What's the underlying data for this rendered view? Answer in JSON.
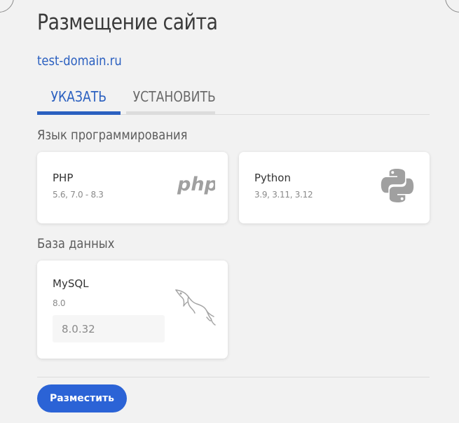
{
  "page": {
    "title": "Размещение сайта",
    "domain": "test-domain.ru"
  },
  "tabs": [
    {
      "label": "УКАЗАТЬ",
      "active": true
    },
    {
      "label": "УСТАНОВИТЬ",
      "active": false
    }
  ],
  "sections": {
    "language_label": "Язык программирования",
    "database_label": "База данных"
  },
  "languages": [
    {
      "name": "PHP",
      "versions": "5.6, 7.0 - 8.3",
      "icon": "php-logo-icon",
      "logo_text": "php"
    },
    {
      "name": "Python",
      "versions": "3.9, 3.11, 3.12",
      "icon": "python-logo-icon"
    }
  ],
  "database": {
    "name": "MySQL",
    "version": "8.0",
    "input_value": "8.0.32",
    "icon": "mysql-dolphin-icon"
  },
  "actions": {
    "submit_label": "Разместить"
  },
  "colors": {
    "accent": "#2b60c0",
    "button": "#2b63d6",
    "background": "#f2f2f2",
    "card": "#ffffff"
  }
}
